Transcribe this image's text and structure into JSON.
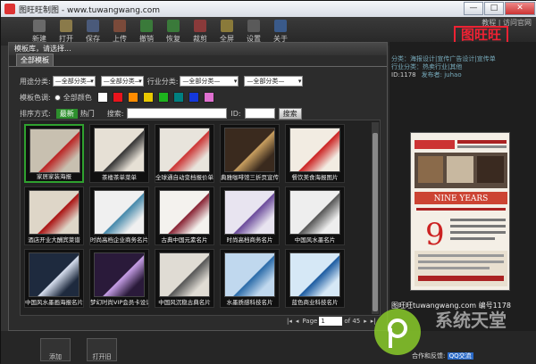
{
  "window": {
    "title": "图旺旺制图 - www.tuwangwang.com",
    "min": "—",
    "max": "□",
    "close": "✕"
  },
  "toolbar": {
    "items": [
      "新建",
      "打开",
      "保存",
      "上传",
      "撤销",
      "恢复",
      "裁剪",
      "全屏",
      "设置",
      "关于"
    ]
  },
  "toplinks": "教程 | 访问官网",
  "brand": "图旺旺",
  "dialog": {
    "title": "模板库，请选择...",
    "tab": "全部模板",
    "filters": {
      "usage_label": "用途分类:",
      "usage_value1": "—全部分类—",
      "usage_value2": "—全部分类—",
      "industry_label": "行业分类:",
      "industry_value1": "—全部分类—",
      "industry_value2": "—全部分类—",
      "color_label": "模板色调:",
      "all_colors": "全部颜色",
      "sort_label": "排序方式:",
      "sort_new": "最新",
      "sort_hot": "热门",
      "search_label": "搜索:",
      "id_label": "ID:",
      "search_button": "搜索"
    },
    "swatch_colors": [
      "#ffffff",
      "#e8141c",
      "#ff8c00",
      "#e8c800",
      "#1db41d",
      "#008080",
      "#1438dc",
      "#e070d0"
    ],
    "cards": [
      {
        "caption": "家居家装海报",
        "bg": "#c8c0b0",
        "accent": "#b22"
      },
      {
        "caption": "茶楼茶单菜单",
        "bg": "#e6e0d5",
        "accent": "#333"
      },
      {
        "caption": "全球通自动变档报价单",
        "bg": "#e8e4dc",
        "accent": "#c33"
      },
      {
        "caption": "典雅咖啡馆三折页宣传",
        "bg": "#3a2a1e",
        "accent": "#caa060"
      },
      {
        "caption": "餐饮美食海报图片",
        "bg": "#f2ece2",
        "accent": "#c22"
      },
      {
        "caption": "酒店开业大酬宾菜谱",
        "bg": "#ded6c8",
        "accent": "#a11"
      },
      {
        "caption": "时尚高档企业商务名片",
        "bg": "#f0f0f0",
        "accent": "#48a"
      },
      {
        "caption": "古典中国元素名片",
        "bg": "#f4f2ee",
        "accent": "#823"
      },
      {
        "caption": "时尚高档商务名片",
        "bg": "#e8e4f0",
        "accent": "#6a4a9a"
      },
      {
        "caption": "中国风水墨名片",
        "bg": "#eeeeee",
        "accent": "#555"
      },
      {
        "caption": "中国风水墨画海报名片",
        "bg": "#1e2a3e",
        "accent": "#d8e0f0"
      },
      {
        "caption": "梦幻时尚VIP会员卡设计",
        "bg": "#2a1a3a",
        "accent": "#c8a0e8"
      },
      {
        "caption": "中国风沉稳古典名片",
        "bg": "#e0dcd4",
        "accent": "#555"
      },
      {
        "caption": "水墨质感科技名片",
        "bg": "#c0d8ee",
        "accent": "#2a6aa8"
      },
      {
        "caption": "蓝色商业科技名片",
        "bg": "#d6e8f6",
        "accent": "#1a5aa0"
      }
    ],
    "pager": {
      "first": "|◂",
      "prev": "◂",
      "page_label": "Page",
      "page_value": "1",
      "of_label": "of 45",
      "next": "▸",
      "last": "▸|"
    }
  },
  "right_panel": {
    "category_line1": "分类：海报设计|宣传广告设计|宣传单",
    "category_line2": "行业分类：热卖行业|其他",
    "id": "ID:1178",
    "publisher": "发布者: juhao",
    "credit": "图旺旺tuwangwang.com 编号1178",
    "poster_title": "NINE YEARS",
    "poster_number": "9"
  },
  "bottom": {
    "btn1": "添加",
    "btn2": "打开旧"
  },
  "watermark": "系统天堂",
  "hint": {
    "label": "合作和反馈:",
    "link": "QQ交流"
  }
}
